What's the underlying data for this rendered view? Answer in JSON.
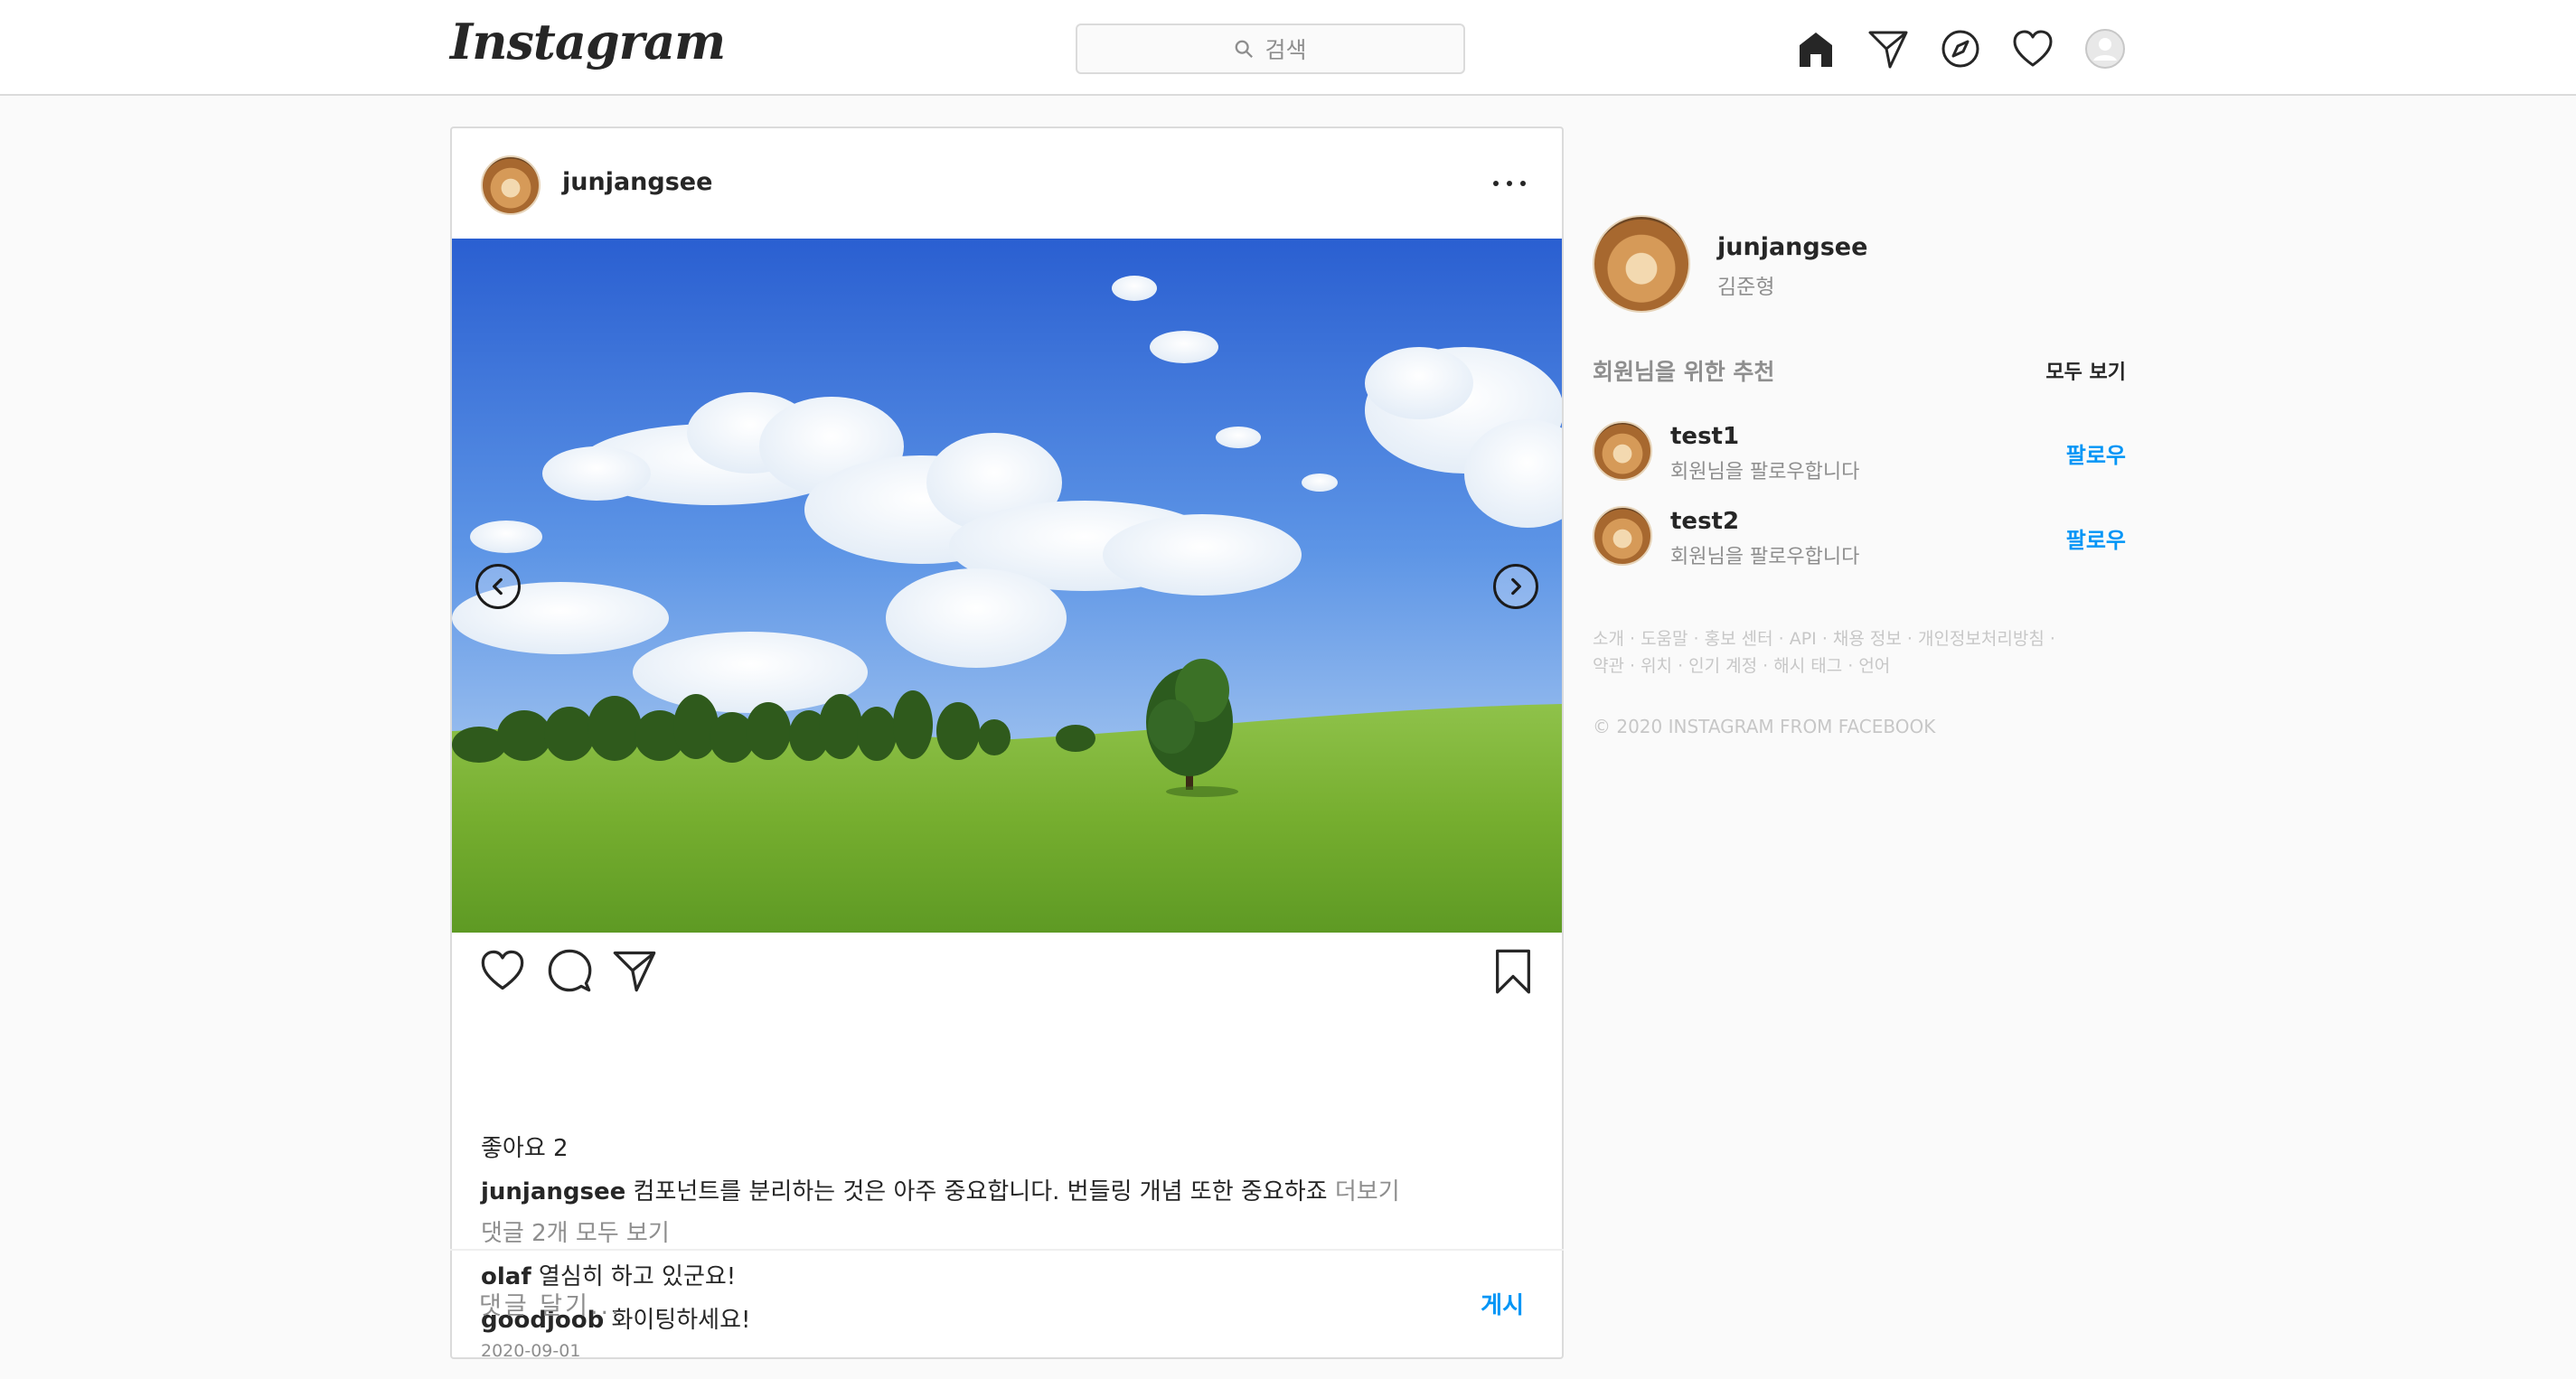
{
  "brand": {
    "logo_text": "Instagram"
  },
  "header": {
    "search_placeholder": "검색",
    "icons": [
      "home-icon",
      "direct-icon",
      "explore-icon",
      "activity-heart-icon",
      "profile-avatar-icon"
    ]
  },
  "post": {
    "username": "junjangsee",
    "likes_label": "좋아요 2",
    "caption": {
      "username": "junjangsee",
      "text": "컴포넌트를 분리하는 것은 아주 중요합니다. 번들링 개념 또한 중요하죠",
      "more": "더보기"
    },
    "view_comments": "댓글 2개 모두 보기",
    "comments": [
      {
        "username": "olaf",
        "text": "열심히 하고 있군요!"
      },
      {
        "username": "goodjoob",
        "text": "화이팅하세요!"
      }
    ],
    "date": "2020-09-01",
    "comment_placeholder": "댓글 달기...",
    "post_button": "게시"
  },
  "sidebar": {
    "me": {
      "username": "junjangsee",
      "name": "김준형"
    },
    "recommend_title": "회원님을 위한 추천",
    "see_all": "모두 보기",
    "suggestions": [
      {
        "username": "test1",
        "subtitle": "회원님을 팔로우합니다",
        "action": "팔로우"
      },
      {
        "username": "test2",
        "subtitle": "회원님을 팔로우합니다",
        "action": "팔로우"
      }
    ],
    "footer_links_line1": "소개 · 도움말 · 홍보 센터 · API · 채용 정보 · 개인정보처리방침 ·",
    "footer_links_line2": "약관 · 위치 · 인기 계정 · 해시 태그 · 언어",
    "copyright": "© 2020 INSTAGRAM FROM FACEBOOK"
  },
  "colors": {
    "link_blue": "#0095f6",
    "muted": "#8e8e8e",
    "border": "#dbdbdb"
  }
}
